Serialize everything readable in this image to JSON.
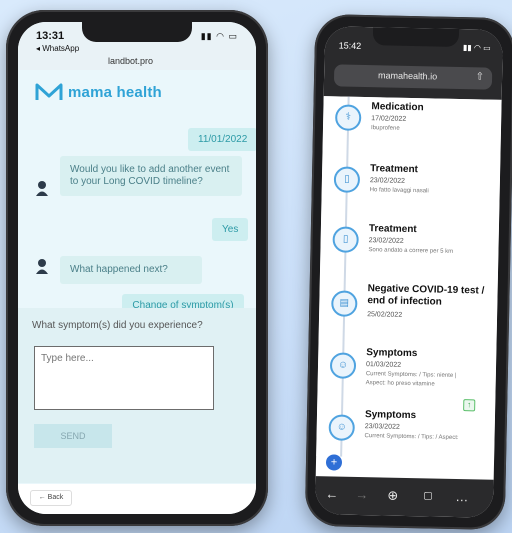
{
  "left_phone": {
    "status": {
      "time": "13:31",
      "back_app": "◂ WhatsApp",
      "url": "landbot.pro"
    },
    "brand": {
      "name": "mama health"
    },
    "chat": {
      "date_badge": "11/01/2022",
      "bot_message_1": "Would you like to add another event to your Long COVID timeline?",
      "user_reply_1": "Yes",
      "bot_message_2": "What happened next?",
      "user_reply_2": "Change of symptom(s)"
    },
    "input_panel": {
      "question": "What symptom(s) did you experience?",
      "placeholder": "Type here...",
      "send_label": "SEND"
    },
    "footer": {
      "back_label": "← Back"
    }
  },
  "right_phone": {
    "status": {
      "time": "15:42"
    },
    "url": "mamahealth.io",
    "timeline": [
      {
        "title": "Medication",
        "date": "17/02/2022",
        "desc": "Ibuprofene",
        "icon": "pills-icon"
      },
      {
        "title": "Treatment",
        "date": "23/02/2022",
        "desc": "Ho fatto lavaggi nasali",
        "icon": "bottle-icon"
      },
      {
        "title": "Treatment",
        "date": "23/02/2022",
        "desc": "Sono andato a correre per 5 km",
        "icon": "bottle-icon"
      },
      {
        "title": "Negative COVID-19 test / end of infection",
        "date": "25/02/2022",
        "desc": "",
        "icon": "test-icon"
      },
      {
        "title": "Symptoms",
        "date": "01/03/2022",
        "desc": "Current Symptoms: / Tips: niente | Aspect: ho preso vitamine",
        "icon": "person-icon"
      },
      {
        "title": "Symptoms",
        "date": "23/03/2022",
        "desc": "Current Symptoms: / Tips: / Aspect:",
        "icon": "person-icon"
      }
    ],
    "fab_label": "+",
    "green_label": "↑"
  }
}
